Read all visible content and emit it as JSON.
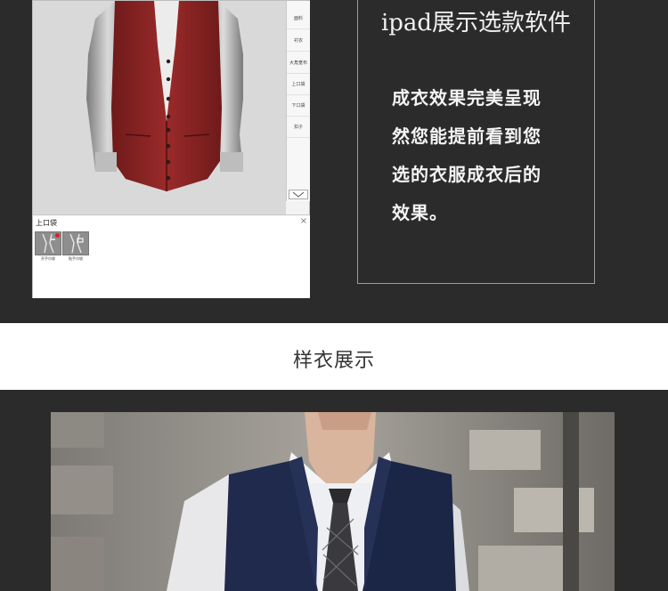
{
  "software": {
    "sidebar_items": [
      "面料",
      "衬衣",
      "大角宽布",
      "上口袋",
      "下口袋",
      "扣子"
    ],
    "pocket_panel": {
      "title": "上口袋",
      "close_glyph": "×",
      "options": [
        {
          "caption": "开手巾袋",
          "selected": true
        },
        {
          "caption": "贴手巾袋",
          "selected": false
        }
      ]
    }
  },
  "promo": {
    "title": "ipad展示选款软件",
    "lines": [
      "成衣效果完美呈现",
      "然您能提前看到您",
      "选的衣服成衣后的",
      "效果。"
    ]
  },
  "heading": {
    "text": "样衣展示"
  },
  "colors": {
    "background": "#2b2b2b",
    "vest_red": "#8e2222",
    "vest_navy": "#1f2a4d",
    "selection_dot": "#e02020"
  }
}
